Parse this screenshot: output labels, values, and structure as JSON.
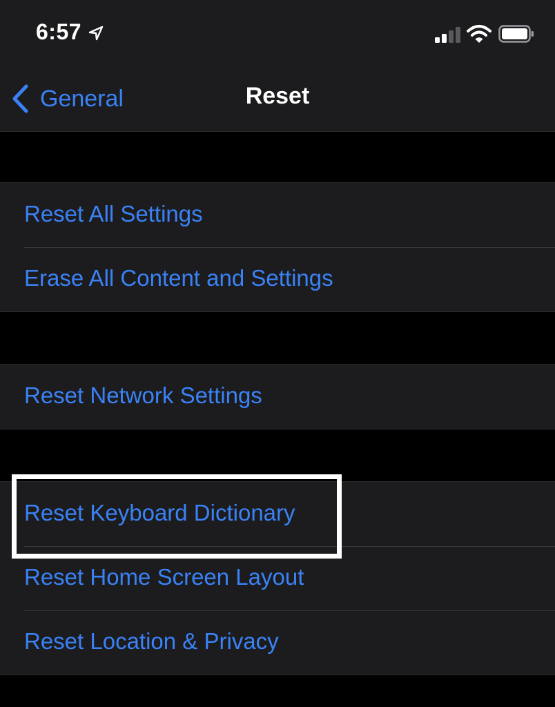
{
  "status_bar": {
    "time": "6:57",
    "icons": [
      "location-arrow-icon",
      "cellular-signal-icon",
      "wifi-icon",
      "battery-icon"
    ]
  },
  "nav": {
    "back_label": "General",
    "title": "Reset"
  },
  "groups": [
    {
      "items": [
        {
          "label": "Reset All Settings"
        },
        {
          "label": "Erase All Content and Settings"
        }
      ]
    },
    {
      "items": [
        {
          "label": "Reset Network Settings"
        }
      ]
    },
    {
      "items": [
        {
          "label": "Reset Keyboard Dictionary"
        },
        {
          "label": "Reset Home Screen Layout"
        },
        {
          "label": "Reset Location & Privacy"
        }
      ]
    }
  ],
  "colors": {
    "accent": "#3a82f6",
    "cell_background": "#1c1c1e",
    "page_background": "#000000",
    "highlight_border": "#ffffff"
  }
}
